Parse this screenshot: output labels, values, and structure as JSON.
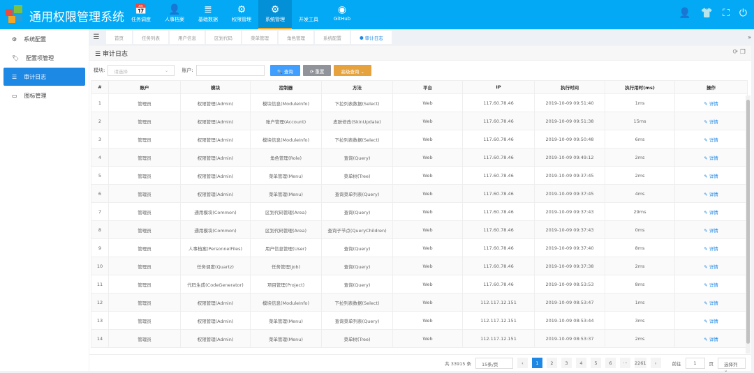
{
  "app": {
    "title": "通用权限管理系统"
  },
  "nav": [
    {
      "label": "任务调度",
      "icon": "calendar-icon"
    },
    {
      "label": "人事档案",
      "icon": "user-icon"
    },
    {
      "label": "基础数据",
      "icon": "database-icon"
    },
    {
      "label": "权限管理",
      "icon": "cogs-icon"
    },
    {
      "label": "系统管理",
      "icon": "gear-icon"
    },
    {
      "label": "开发工具",
      "icon": "code-icon"
    },
    {
      "label": "GitHub",
      "icon": "github-icon"
    }
  ],
  "sidebar": [
    {
      "label": "系统配置"
    },
    {
      "label": "配置项管理"
    },
    {
      "label": "审计日志"
    },
    {
      "label": "图标管理"
    }
  ],
  "tabs": [
    "首页",
    "任务列表",
    "用户信息",
    "区划代码",
    "菜单管理",
    "角色管理",
    "系统配置",
    "审计日志"
  ],
  "panel": {
    "title": "审计日志"
  },
  "filter": {
    "module_label": "模块:",
    "module_placeholder": "请选择",
    "account_label": "账户:",
    "search": "查询",
    "reset": "重置",
    "advanced": "高级查询"
  },
  "table": {
    "headers": [
      "#",
      "账户",
      "模块",
      "控制器",
      "方法",
      "平台",
      "IP",
      "执行时间",
      "执行用时(ms)",
      "操作"
    ],
    "rows": [
      [
        "1",
        "管理员",
        "权限管理(Admin)",
        "模块信息(ModuleInfo)",
        "下拉列表数据(Select)",
        "Web",
        "117.60.78.46",
        "2019-10-09 09:51:40",
        "1ms",
        "详情"
      ],
      [
        "2",
        "管理员",
        "权限管理(Admin)",
        "账户管理(Account)",
        "皮肤修改(SkinUpdate)",
        "Web",
        "117.60.78.46",
        "2019-10-09 09:51:38",
        "15ms",
        "详情"
      ],
      [
        "3",
        "管理员",
        "权限管理(Admin)",
        "模块信息(ModuleInfo)",
        "下拉列表数据(Select)",
        "Web",
        "117.60.78.46",
        "2019-10-09 09:50:48",
        "6ms",
        "详情"
      ],
      [
        "4",
        "管理员",
        "权限管理(Admin)",
        "角色管理(Role)",
        "查询(Query)",
        "Web",
        "117.60.78.46",
        "2019-10-09 09:49:12",
        "2ms",
        "详情"
      ],
      [
        "5",
        "管理员",
        "权限管理(Admin)",
        "菜单管理(Menu)",
        "菜单树(Tree)",
        "Web",
        "117.60.78.46",
        "2019-10-09 09:37:45",
        "2ms",
        "详情"
      ],
      [
        "6",
        "管理员",
        "权限管理(Admin)",
        "菜单管理(Menu)",
        "查询菜单列表(Query)",
        "Web",
        "117.60.78.46",
        "2019-10-09 09:37:45",
        "4ms",
        "详情"
      ],
      [
        "7",
        "管理员",
        "通用模块(Common)",
        "区划代码管理(Area)",
        "查询(Query)",
        "Web",
        "117.60.78.46",
        "2019-10-09 09:37:43",
        "29ms",
        "详情"
      ],
      [
        "8",
        "管理员",
        "通用模块(Common)",
        "区划代码管理(Area)",
        "查询子节点(QueryChildren)",
        "Web",
        "117.60.78.46",
        "2019-10-09 09:37:43",
        "0ms",
        "详情"
      ],
      [
        "9",
        "管理员",
        "人事档案(PersonnelFiles)",
        "用户信息管理(User)",
        "查询(Query)",
        "Web",
        "117.60.78.46",
        "2019-10-09 09:37:40",
        "8ms",
        "详情"
      ],
      [
        "10",
        "管理员",
        "任务调度(Quartz)",
        "任务管理(Job)",
        "查询(Query)",
        "Web",
        "117.60.78.46",
        "2019-10-09 09:37:38",
        "2ms",
        "详情"
      ],
      [
        "11",
        "管理员",
        "代码生成(CodeGenerator)",
        "项目管理(Project)",
        "查询(Query)",
        "Web",
        "117.60.78.46",
        "2019-10-09 08:53:53",
        "8ms",
        "详情"
      ],
      [
        "12",
        "管理员",
        "权限管理(Admin)",
        "模块信息(ModuleInfo)",
        "下拉列表数据(Select)",
        "Web",
        "112.117.12.151",
        "2019-10-09 08:53:47",
        "1ms",
        "详情"
      ],
      [
        "13",
        "管理员",
        "权限管理(Admin)",
        "菜单管理(Menu)",
        "查询菜单列表(Query)",
        "Web",
        "112.117.12.151",
        "2019-10-09 08:53:44",
        "3ms",
        "详情"
      ],
      [
        "14",
        "管理员",
        "权限管理(Admin)",
        "菜单管理(Menu)",
        "菜单树(Tree)",
        "Web",
        "112.117.12.151",
        "2019-10-09 08:53:37",
        "2ms",
        "详情"
      ]
    ]
  },
  "pagination": {
    "total": "共 33915 条",
    "page_size": "15条/页",
    "pages": [
      "1",
      "2",
      "3",
      "4",
      "5",
      "6",
      "···",
      "2261"
    ],
    "goto_label": "前往",
    "goto_value": "1",
    "page_unit": "页",
    "columns": "选择列"
  }
}
